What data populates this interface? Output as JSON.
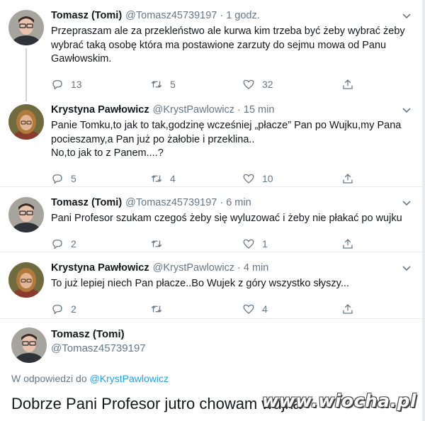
{
  "tweets": [
    {
      "name": "Tomasz (Tomi)",
      "handle": "@Tomasz45739197",
      "time": "1 godz.",
      "lines": [
        "Przepraszam ale za przekleństwo ale kurwa kim trzeba być żeby wybrać żeby",
        "wybrać taką osobę która ma postawione zarzuty do sejmu mowa od Panu",
        "Gawłowskim."
      ],
      "replies": "13",
      "retweets": "5",
      "likes": "32"
    },
    {
      "name": "Krystyna Pawłowicz",
      "handle": "@KrystPawlowicz",
      "time": "15 min",
      "lines": [
        "Panie Tomku,to jak to tak,godzinę wcześniej „płacze” Pan po Wujku,my Pana",
        "pocieszamy,a Pan już po żałobie i przeklina..",
        "No,to jak to z Panem....?"
      ],
      "replies": "5",
      "retweets": "4",
      "likes": "10"
    },
    {
      "name": "Tomasz (Tomi)",
      "handle": "@Tomasz45739197",
      "time": "6 min",
      "lines": [
        "Pani Profesor szukam czegoś żeby się wyluzować i żeby nie płakać po wujku"
      ],
      "replies": "2",
      "retweets": "",
      "likes": "1"
    },
    {
      "name": "Krystyna Pawłowicz",
      "handle": "@KrystPawlowicz",
      "time": "4 min",
      "lines": [
        "To już lepiej niech Pan płacze..Bo Wujek z góry wszystko słyszy..."
      ],
      "replies": "2",
      "retweets": "",
      "likes": "4"
    }
  ],
  "final_tweet": {
    "name": "Tomasz (Tomi)",
    "handle": "@Tomasz45739197",
    "reply_prefix": "W odpowiedzi do",
    "reply_to": "@KrystPawlowicz",
    "text": "Dobrze Pani Profesor jutro chowam wujka"
  },
  "watermark": "www.wiocha.pl",
  "colors": {
    "accent": "#1da1f2",
    "secondary_text": "#657786",
    "border": "#e6ecf0"
  },
  "icons": [
    "reply-icon",
    "retweet-icon",
    "like-icon",
    "share-icon",
    "caret-down-icon"
  ]
}
